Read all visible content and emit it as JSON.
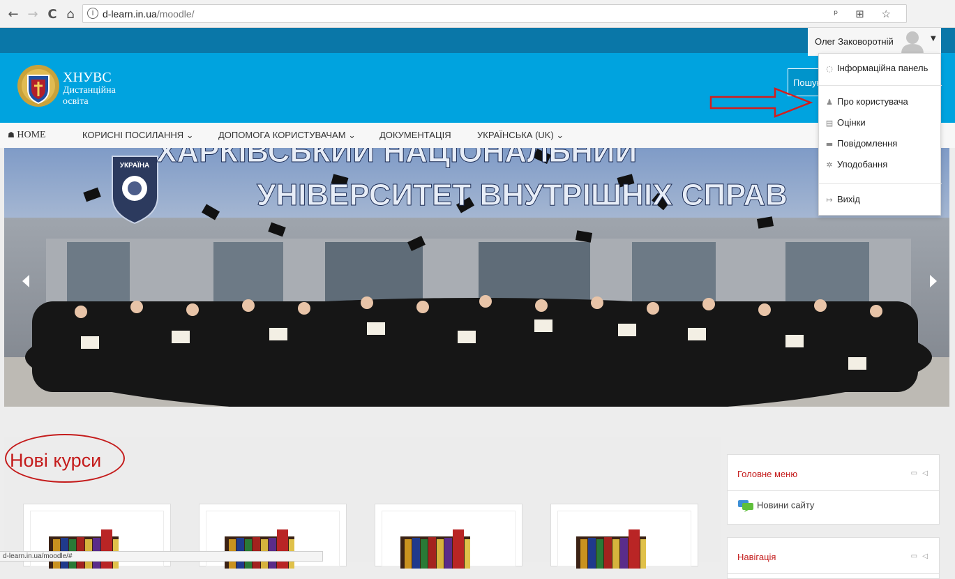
{
  "browser": {
    "back": "←",
    "forward": "→",
    "reload": "C",
    "home": "⌂",
    "url_host": "d-learn.in.ua",
    "url_path": "/moodle/",
    "info_icon": "i",
    "right_icons": "ᵖ ⊞ ☆"
  },
  "header": {
    "title_line1": "ХНУВС",
    "title_line2": "Дистанційна",
    "title_line3": "освіта",
    "search_label": "Пошук"
  },
  "nav": {
    "home": "HOME",
    "home_icon": "☗",
    "useful_links": "КОРИСНІ ПОСИЛАННЯ ⌄",
    "help": "ДОПОМОГА КОРИСТУВАЧАМ ⌄",
    "docs": "ДОКУМЕНТАЦІЯ",
    "language": "УКРАЇНСЬКА (UK) ⌄"
  },
  "slider": {
    "banner_line1": "ХАРКІВСЬКИЙ НАЦІОНАЛЬНИЙ",
    "banner_line2": "УНІВЕРСИТЕТ ВНУТРІШНІХ СПРАВ",
    "badge_text": "УКРАЇНА"
  },
  "user_menu": {
    "name": "Олег Заковоротній",
    "caret": "▼",
    "items": [
      {
        "label": "Інформаційна панель",
        "icon": "dashboard-icon",
        "glyph": "◌"
      },
      {
        "label": "Про користувача",
        "icon": "user-icon",
        "glyph": "♟"
      },
      {
        "label": "Оцінки",
        "icon": "grades-icon",
        "glyph": "▤"
      },
      {
        "label": "Повідомлення",
        "icon": "message-icon",
        "glyph": "▬"
      },
      {
        "label": "Уподобання",
        "icon": "gear-icon",
        "glyph": "✲"
      },
      {
        "label": "Вихід",
        "icon": "logout-icon",
        "glyph": "↦"
      }
    ]
  },
  "main": {
    "section_title": "Нові курси",
    "course_count": 4
  },
  "sidebar": {
    "main_menu_title": "Головне меню",
    "main_menu_item": "Новини сайту",
    "navigation_title": "Навігація",
    "block_controls": "▭ ◁"
  },
  "statusbar": {
    "text": "d-learn.in.ua/moodle/#"
  },
  "colors": {
    "header_blue": "#00a3df",
    "top_band": "#0a77a8",
    "accent_red": "#c41b1b"
  }
}
